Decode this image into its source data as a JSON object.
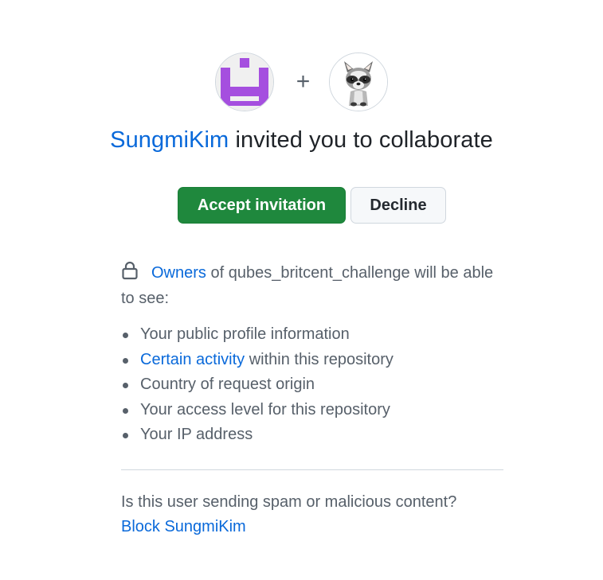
{
  "invite": {
    "inviter": "SungmiKim",
    "headline_rest": " invited you to collaborate",
    "plus": "+"
  },
  "actions": {
    "accept_label": "Accept invitation",
    "decline_label": "Decline"
  },
  "privacy": {
    "owners_link": "Owners",
    "repo_text": " of qubes_britcent_challenge will be able to see:",
    "items": [
      {
        "text": "Your public profile information"
      },
      {
        "link": "Certain activity",
        "text": " within this repository"
      },
      {
        "text": "Country of request origin"
      },
      {
        "text": "Your access level for this repository"
      },
      {
        "text": "Your IP address"
      }
    ]
  },
  "spam": {
    "question": "Is this user sending spam or malicious content?",
    "block_link": "Block SungmiKim"
  },
  "colors": {
    "accent": "#0969da",
    "accept_green": "#1f883d",
    "identicon_purple": "#a54fdf"
  },
  "icons": {
    "lock": "lock-icon",
    "inviter_avatar": "identicon-avatar",
    "user_avatar": "raccoon-avatar"
  }
}
